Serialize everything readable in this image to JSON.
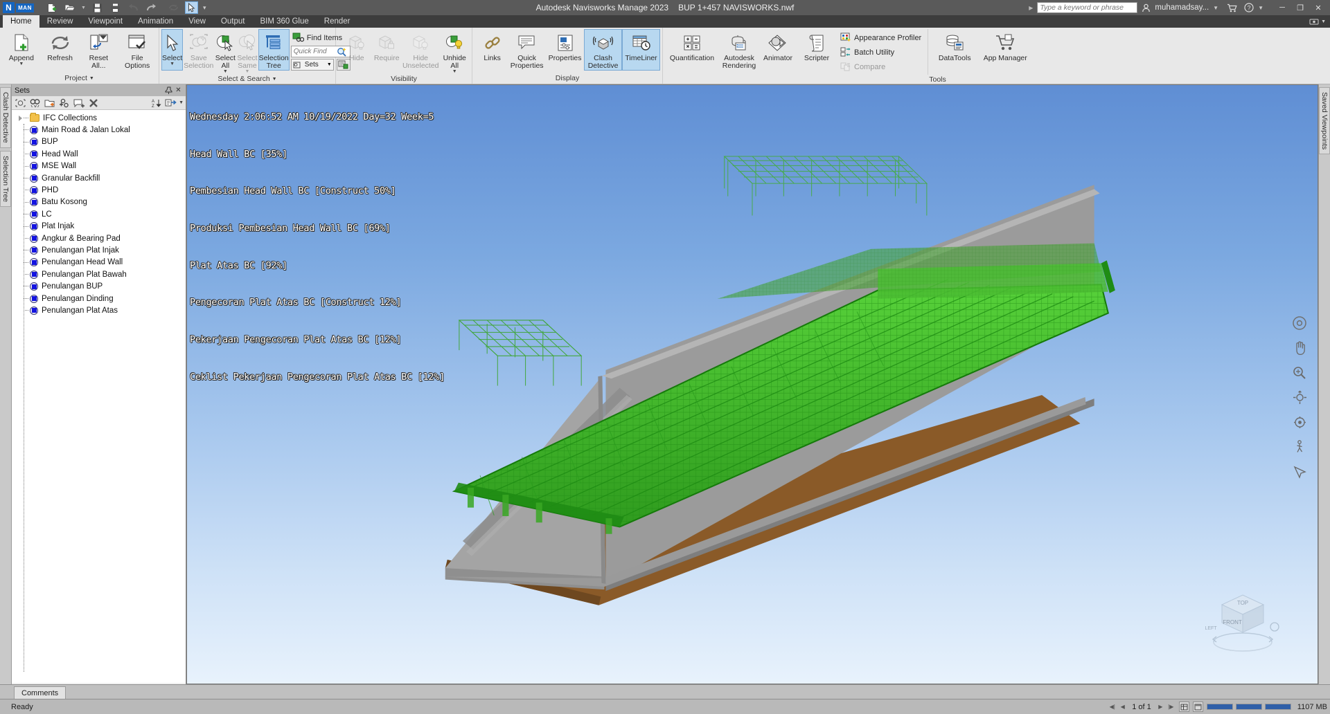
{
  "titlebar": {
    "logo_n": "N",
    "logo_man": "MAN",
    "app_title": "Autodesk Navisworks Manage 2023",
    "file_name": "BUP 1+457 NAVISWORKS.nwf",
    "search_placeholder": "Type a keyword or phrase",
    "user_name": "muhamadsay...",
    "quick_access": [
      {
        "name": "new-document-icon",
        "label": "New"
      },
      {
        "name": "open-folder-icon",
        "label": "Open"
      },
      {
        "name": "save-icon",
        "label": "Save"
      },
      {
        "name": "print-icon",
        "label": "Print"
      },
      {
        "name": "undo-icon",
        "label": "Undo"
      },
      {
        "name": "redo-icon",
        "label": "Redo"
      },
      {
        "name": "refresh-icon",
        "label": "Refresh"
      },
      {
        "name": "select-cursor-icon",
        "label": "Select"
      }
    ],
    "window_buttons": [
      "minimize",
      "maximize",
      "close"
    ]
  },
  "ribbon": {
    "tabs": [
      {
        "label": "Home",
        "active": true
      },
      {
        "label": "Review",
        "active": false
      },
      {
        "label": "Viewpoint",
        "active": false
      },
      {
        "label": "Animation",
        "active": false
      },
      {
        "label": "View",
        "active": false
      },
      {
        "label": "Output",
        "active": false
      },
      {
        "label": "BIM 360 Glue",
        "active": false
      },
      {
        "label": "Render",
        "active": false
      }
    ],
    "groups": [
      {
        "name": "project",
        "label": "Project",
        "has_dropdown": true,
        "buttons": [
          {
            "label": "Append",
            "icon": "append-icon",
            "dropdown": true,
            "state": "normal"
          },
          {
            "label": "Refresh",
            "icon": "refresh-icon",
            "dropdown": false,
            "state": "normal"
          },
          {
            "label": "Reset\nAll...",
            "icon": "reset-all-icon",
            "dropdown": true,
            "state": "normal"
          },
          {
            "label": "File\nOptions",
            "icon": "file-options-icon",
            "dropdown": false,
            "state": "normal"
          }
        ]
      },
      {
        "name": "select-search",
        "label": "Select & Search",
        "has_dropdown": true,
        "buttons": [
          {
            "label": "Select",
            "icon": "select-arrow-icon",
            "dropdown": true,
            "state": "selected"
          },
          {
            "label": "Save\nSelection",
            "icon": "save-selection-icon",
            "dropdown": false,
            "state": "disabled"
          },
          {
            "label": "Select\nAll",
            "icon": "select-all-icon",
            "dropdown": true,
            "state": "normal"
          },
          {
            "label": "Select\nSame",
            "icon": "select-same-icon",
            "dropdown": true,
            "state": "disabled"
          },
          {
            "label": "Selection\nTree",
            "icon": "selection-tree-icon",
            "dropdown": false,
            "state": "selected"
          }
        ],
        "stack": [
          {
            "label": "Find Items",
            "icon": "find-items-icon",
            "type": "row"
          },
          {
            "label": "Quick Find",
            "icon": "quick-find-icon",
            "type": "input"
          },
          {
            "label": "Sets",
            "icon": "sets-icon",
            "type": "dropdown"
          }
        ]
      },
      {
        "name": "visibility",
        "label": "Visibility",
        "has_dropdown": false,
        "buttons": [
          {
            "label": "Hide",
            "icon": "hide-icon",
            "dropdown": false,
            "state": "disabled"
          },
          {
            "label": "Require",
            "icon": "require-icon",
            "dropdown": false,
            "state": "disabled"
          },
          {
            "label": "Hide\nUnselected",
            "icon": "hide-unselected-icon",
            "dropdown": false,
            "state": "disabled"
          },
          {
            "label": "Unhide\nAll",
            "icon": "unhide-all-icon",
            "dropdown": true,
            "state": "normal"
          }
        ]
      },
      {
        "name": "display",
        "label": "Display",
        "has_dropdown": false,
        "buttons": [
          {
            "label": "Links",
            "icon": "links-icon",
            "dropdown": false,
            "state": "normal"
          },
          {
            "label": "Quick\nProperties",
            "icon": "quick-properties-icon",
            "dropdown": false,
            "state": "normal"
          },
          {
            "label": "Properties",
            "icon": "properties-icon",
            "dropdown": false,
            "state": "normal"
          },
          {
            "label": "Clash\nDetective",
            "icon": "clash-detective-icon",
            "dropdown": false,
            "state": "selected"
          },
          {
            "label": "TimeLiner",
            "icon": "timeliner-icon",
            "dropdown": false,
            "state": "selected"
          }
        ]
      },
      {
        "name": "tools",
        "label": "Tools",
        "has_dropdown": false,
        "buttons": [
          {
            "label": "Quantification",
            "icon": "quantification-icon",
            "dropdown": false,
            "state": "normal"
          },
          {
            "label": "Autodesk\nRendering",
            "icon": "autodesk-rendering-icon",
            "dropdown": false,
            "state": "normal"
          },
          {
            "label": "Animator",
            "icon": "animator-icon",
            "dropdown": false,
            "state": "normal"
          },
          {
            "label": "Scripter",
            "icon": "scripter-icon",
            "dropdown": false,
            "state": "normal"
          }
        ],
        "stack": [
          {
            "label": "Appearance Profiler",
            "icon": "appearance-profiler-icon",
            "type": "row",
            "state": "normal"
          },
          {
            "label": "Batch Utility",
            "icon": "batch-utility-icon",
            "type": "row",
            "state": "normal"
          },
          {
            "label": "Compare",
            "icon": "compare-icon",
            "type": "row",
            "state": "disabled"
          }
        ],
        "extra_buttons": [
          {
            "label": "DataTools",
            "icon": "datatools-icon",
            "dropdown": false,
            "state": "normal"
          },
          {
            "label": "App Manager",
            "icon": "app-manager-icon",
            "dropdown": false,
            "state": "normal"
          }
        ]
      }
    ]
  },
  "left_rail": {
    "tabs": [
      "Clash Detective",
      "Selection Tree"
    ]
  },
  "right_rail": {
    "tabs": [
      "Saved Viewpoints"
    ]
  },
  "sets_panel": {
    "title": "Sets",
    "title_buttons": [
      {
        "name": "auto-hide-icon",
        "glyph": "⚲"
      },
      {
        "name": "close-icon",
        "glyph": "✕"
      }
    ],
    "toolbar": [
      {
        "name": "save-selection-set-icon"
      },
      {
        "name": "save-search-set-icon"
      },
      {
        "name": "new-folder-icon"
      },
      {
        "name": "add-copy-icon"
      },
      {
        "name": "add-comment-icon"
      },
      {
        "name": "delete-icon"
      },
      {
        "name": "sort-az-icon"
      },
      {
        "name": "import-export-icon"
      }
    ],
    "tree": [
      {
        "label": "IFC Collections",
        "type": "folder",
        "expandable": true
      },
      {
        "label": "Main Road & Jalan Lokal",
        "type": "set"
      },
      {
        "label": "BUP",
        "type": "set"
      },
      {
        "label": "Head Wall",
        "type": "set"
      },
      {
        "label": "MSE Wall",
        "type": "set"
      },
      {
        "label": "Granular Backfill",
        "type": "set"
      },
      {
        "label": "PHD",
        "type": "set"
      },
      {
        "label": "Batu Kosong",
        "type": "set"
      },
      {
        "label": "LC",
        "type": "set"
      },
      {
        "label": "Plat Injak",
        "type": "set"
      },
      {
        "label": "Angkur & Bearing Pad",
        "type": "set"
      },
      {
        "label": "Penulangan Plat Injak",
        "type": "set"
      },
      {
        "label": "Penulangan Head Wall",
        "type": "set"
      },
      {
        "label": "Penulangan Plat Bawah",
        "type": "set"
      },
      {
        "label": "Penulangan BUP",
        "type": "set"
      },
      {
        "label": "Penulangan Dinding",
        "type": "set"
      },
      {
        "label": "Penulangan Plat Atas",
        "type": "set"
      }
    ]
  },
  "viewport": {
    "timeliner_overlay": [
      "Wednesday 2:06:52 AM 10/19/2022 Day=32 Week=5",
      "Head Wall BC [35%]",
      "Pembesian Head Wall BC [Construct 50%]",
      "Produksi Pembesian Head Wall BC [69%]",
      "Plat Atas BC [92%]",
      "Pengecoran Plat Atas BC [Construct 12%]",
      "Pekerjaan Pengecoran Plat Atas BC [12%]",
      "Ceklist Pekerjaan Pengecoran Plat Atas BC [12%]"
    ],
    "nav_tools": [
      {
        "name": "steering-wheel-icon"
      },
      {
        "name": "pan-hand-icon"
      },
      {
        "name": "zoom-magnifier-icon"
      },
      {
        "name": "orbit-icon"
      },
      {
        "name": "look-around-icon"
      },
      {
        "name": "walk-icon"
      },
      {
        "name": "fly-icon"
      }
    ],
    "viewcube": {
      "top": "TOP",
      "front": "FRONT",
      "left": "LEFT"
    }
  },
  "comments_bar": {
    "tab_label": "Comments"
  },
  "statusbar": {
    "status_text": "Ready",
    "page_text": "1 of 1",
    "memory_text": "1107 MB",
    "nav_buttons": [
      "first",
      "previous",
      "next",
      "last"
    ],
    "view_buttons": [
      {
        "name": "grid-view-icon"
      },
      {
        "name": "window-view-icon"
      }
    ],
    "progress_bars": [
      {
        "name": "progress-bar-1",
        "percent": 100,
        "color": "#2f5fa8"
      },
      {
        "name": "progress-bar-2",
        "percent": 100,
        "color": "#2f5fa8"
      },
      {
        "name": "progress-bar-3",
        "percent": 100,
        "color": "#2f5fa8"
      }
    ]
  }
}
